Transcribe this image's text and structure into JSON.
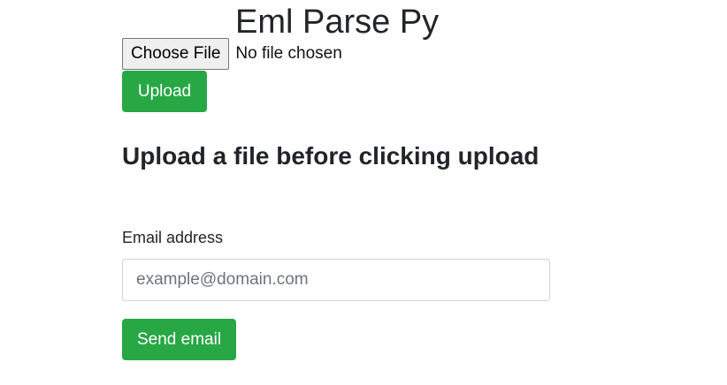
{
  "page": {
    "title": "Eml Parse Py"
  },
  "upload_form": {
    "choose_file_label": "Choose File",
    "file_status": "No file chosen",
    "upload_label": "Upload"
  },
  "message": {
    "heading": "Upload a file before clicking upload"
  },
  "email_form": {
    "label": "Email address",
    "value": "",
    "placeholder": "example@domain.com",
    "send_label": "Send email"
  },
  "colors": {
    "success": "#28a745",
    "text": "#212529",
    "input_border": "#ced4da",
    "placeholder": "#6c757d"
  }
}
